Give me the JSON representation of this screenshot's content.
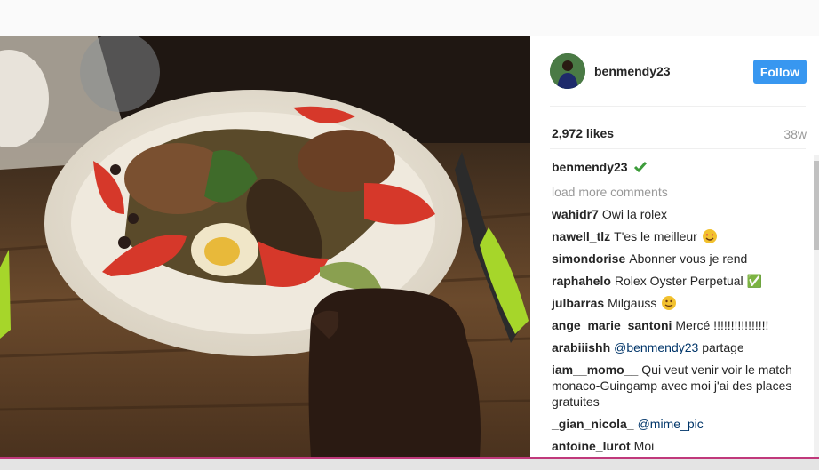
{
  "post": {
    "username": "benmendy23",
    "follow_label": "Follow",
    "likes": "2,972 likes",
    "time": "38w",
    "caption_user": "benmendy23",
    "load_more": "load more comments"
  },
  "comments": [
    {
      "user": "wahidr7",
      "text": "Owi la rolex"
    },
    {
      "user": "nawell_tlz",
      "text": "T'es le meilleur",
      "emoji": "heart-eyes-emoji"
    },
    {
      "user": "simondorise",
      "text": "Abonner vous je rend"
    },
    {
      "user": "raphahelo",
      "text": "Rolex Oyster Perpetual ✅"
    },
    {
      "user": "julbarras",
      "text": "Milgauss",
      "emoji": "smile-emoji"
    },
    {
      "user": "ange_marie_santoni",
      "text": "Mercé !!!!!!!!!!!!!!!!"
    },
    {
      "user": "arabiiishh",
      "mention": "@benmendy23",
      "text": " partage"
    },
    {
      "user": "iam__momo__",
      "text": "Qui veut venir voir le match monaco-Guingamp avec moi j'ai des places gratuites"
    },
    {
      "user": "_gian_nicola_",
      "mention": "@mime_pic",
      "text": ""
    },
    {
      "user": "antoine_lurot",
      "text": "Moi"
    }
  ],
  "colors": {
    "follow": "#3897f0",
    "verified": "#3d9c3a",
    "accent_line": "#c0397b"
  }
}
